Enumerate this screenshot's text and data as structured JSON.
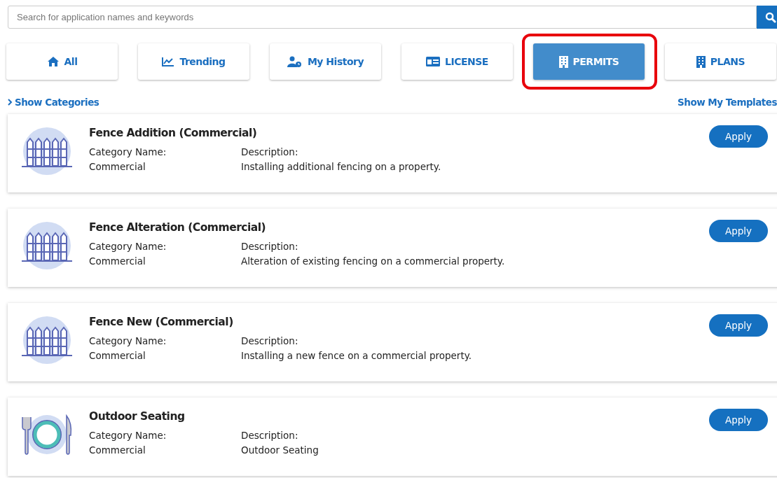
{
  "search": {
    "placeholder": "Search for application names and keywords"
  },
  "tabs": [
    {
      "label": "All",
      "kind": "home",
      "selected": false,
      "highlighted": false
    },
    {
      "label": "Trending",
      "kind": "chart",
      "selected": false,
      "highlighted": false
    },
    {
      "label": "My History",
      "kind": "user",
      "selected": false,
      "highlighted": false
    },
    {
      "label": "LICENSE",
      "kind": "card",
      "selected": false,
      "highlighted": false
    },
    {
      "label": "PERMITS",
      "kind": "building",
      "selected": true,
      "highlighted": true
    },
    {
      "label": "PLANS",
      "kind": "building",
      "selected": false,
      "highlighted": false
    }
  ],
  "show_categories": "Show Categories",
  "show_templates": "Show My Templates",
  "applications": [
    {
      "title": "Fence Addition (Commercial)",
      "kind": "fence",
      "category_label": "Category Name:",
      "category": "Commercial",
      "description_label": "Description:",
      "description": "Installing additional fencing on a property.",
      "button": "Apply"
    },
    {
      "title": "Fence Alteration (Commercial)",
      "kind": "fence",
      "category_label": "Category Name:",
      "category": "Commercial",
      "description_label": "Description:",
      "description": "Alteration of existing fencing on a commercial property.",
      "button": "Apply"
    },
    {
      "title": "Fence New (Commercial)",
      "kind": "fence",
      "category_label": "Category Name:",
      "category": "Commercial",
      "description_label": "Description:",
      "description": "Installing a new fence on a commercial property.",
      "button": "Apply"
    },
    {
      "title": "Outdoor Seating",
      "kind": "dining",
      "category_label": "Category Name:",
      "category": "Commercial",
      "description_label": "Description:",
      "description": "Outdoor Seating",
      "button": "Apply"
    }
  ]
}
